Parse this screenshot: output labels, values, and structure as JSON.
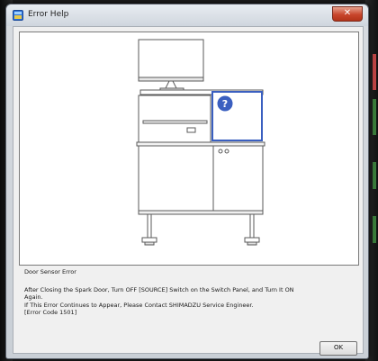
{
  "window": {
    "title": "Error Help",
    "close_glyph": "✕",
    "icon": "app-icon"
  },
  "illustration": {
    "subject": "instrument-with-door-highlight",
    "highlight_color": "#3a5fc0",
    "marker_glyph": "?"
  },
  "message": {
    "heading": "Door Sensor Error",
    "line1": "After Closing the Spark Door, Turn OFF [SOURCE] Switch on the Switch Panel, and Turn It ON",
    "line2": "Again.",
    "line3": "If This Error Continues to Appear, Please Contact SHIMADZU Service Engineer.",
    "line4": "[Error Code 1501]"
  },
  "buttons": {
    "ok_label": "OK"
  }
}
